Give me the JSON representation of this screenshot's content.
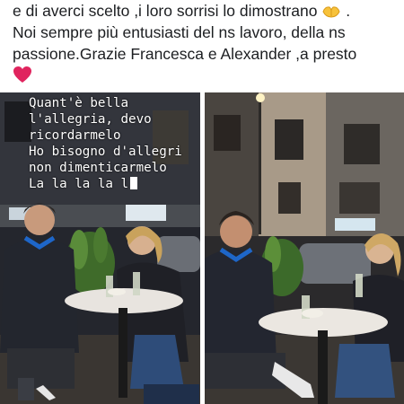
{
  "post": {
    "line1": "e di averci scelto ,i loro sorrisi lo dimostrano",
    "line1_emoji": "hands-heart-icon",
    "line2": "Noi sempre più entusiasti del ns lavoro, della ns",
    "line3": "passione.Grazie Francesca e Alexander ,a presto",
    "line4_emoji": "red-heart-icon"
  },
  "photo_left": {
    "caption_lines": [
      "Quant'è bella",
      "l'allegria, devo",
      "ricordarmelo",
      "Ho bisogno d'allegri",
      "non dimenticarmelo",
      "La la la la l"
    ]
  },
  "colors": {
    "text": "#1c1e21",
    "heart": "#e0245e",
    "emoji_yellow": "#f7c23b"
  }
}
